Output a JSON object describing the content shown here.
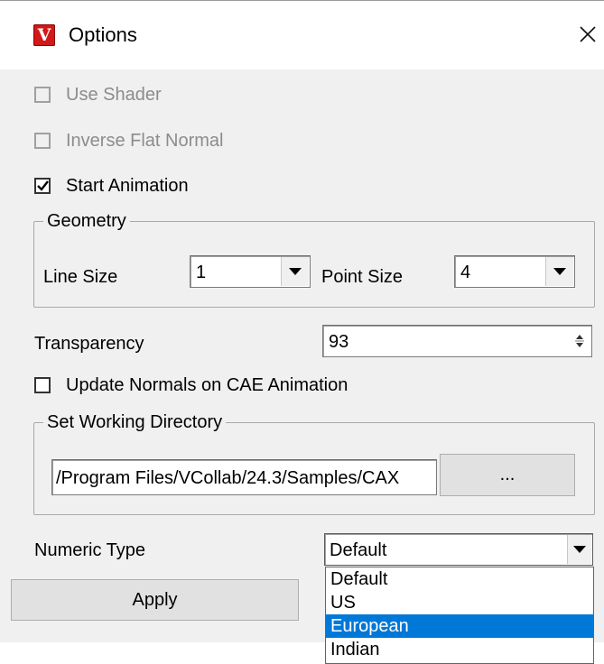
{
  "window": {
    "title": "Options",
    "app_icon_letter": "V",
    "close_glyph": "✕"
  },
  "checkboxes": {
    "use_shader": {
      "label": "Use Shader",
      "checked": false,
      "disabled": true
    },
    "inverse_flat_normal": {
      "label": "Inverse Flat Normal",
      "checked": false,
      "disabled": true
    },
    "start_animation": {
      "label": "Start Animation",
      "checked": true,
      "disabled": false
    },
    "update_normals": {
      "label": "Update Normals on CAE Animation",
      "checked": false,
      "disabled": false
    }
  },
  "geometry": {
    "title": "Geometry",
    "line_size_label": "Line Size",
    "line_size_value": "1",
    "point_size_label": "Point Size",
    "point_size_value": "4"
  },
  "transparency": {
    "label": "Transparency",
    "value": "93"
  },
  "working_directory": {
    "title": "Set Working Directory",
    "path": "/Program Files/VCollab/24.3/Samples/CAX",
    "browse_label": "..."
  },
  "numeric_type": {
    "label": "Numeric Type",
    "value": "Default",
    "options": [
      "Default",
      "US",
      "European",
      "Indian"
    ],
    "highlighted": "European"
  },
  "buttons": {
    "apply_label": "Apply"
  },
  "colors": {
    "selection": "#0078d7",
    "app_icon": "#d21818",
    "dialog_bg": "#f0f0f0"
  }
}
